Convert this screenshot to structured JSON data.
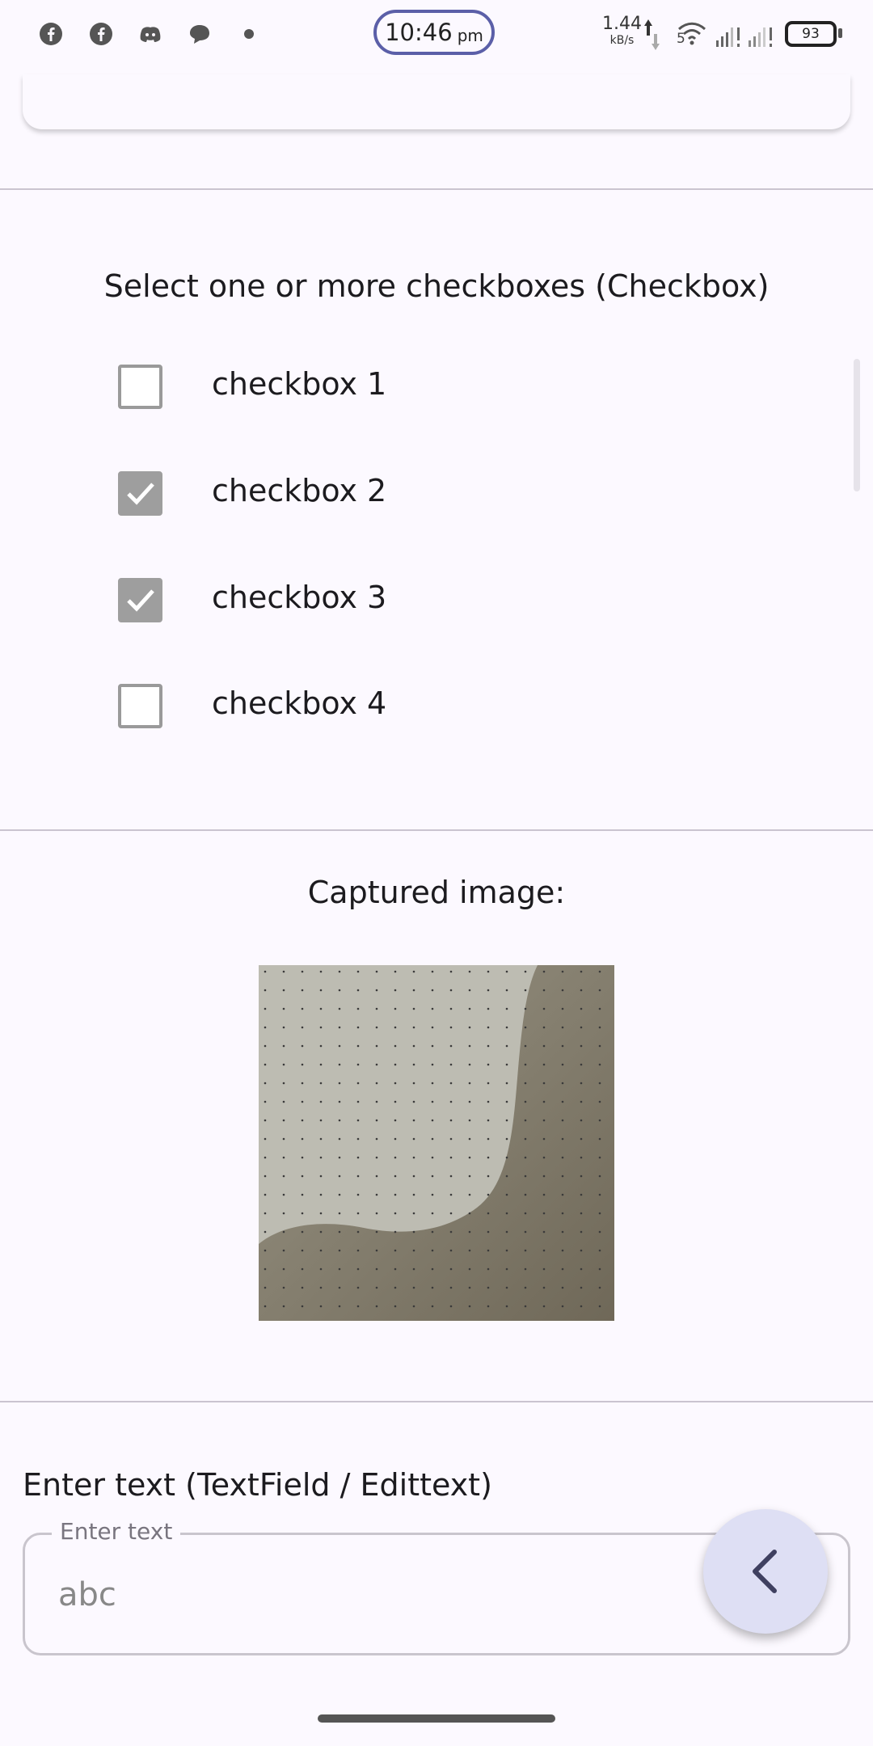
{
  "status_bar": {
    "time": "10:46",
    "ampm": "pm",
    "speed_value": "1.44",
    "speed_unit": "kB/s",
    "network": "5",
    "battery": "93",
    "notification_icons": [
      "facebook-icon",
      "facebook-icon",
      "discord-icon",
      "chat-icon",
      "dot-icon"
    ]
  },
  "checkbox_section": {
    "title": "Select one or more checkboxes (Checkbox)",
    "items": [
      {
        "label": "checkbox 1",
        "checked": false
      },
      {
        "label": "checkbox 2",
        "checked": true
      },
      {
        "label": "checkbox 3",
        "checked": true
      },
      {
        "label": "checkbox 4",
        "checked": false
      }
    ]
  },
  "image_section": {
    "title": "Captured image:"
  },
  "text_field_section": {
    "title": "Enter text (TextField / Edittext)",
    "field_label": "Enter text",
    "value": "abc"
  },
  "fab": {
    "icon": "chevron-left-icon"
  },
  "colors": {
    "background": "#fcf9ff",
    "checkbox_checked": "#9e9e9e",
    "fab_background": "#dedff4",
    "time_pill_border": "#5b5fa8"
  }
}
